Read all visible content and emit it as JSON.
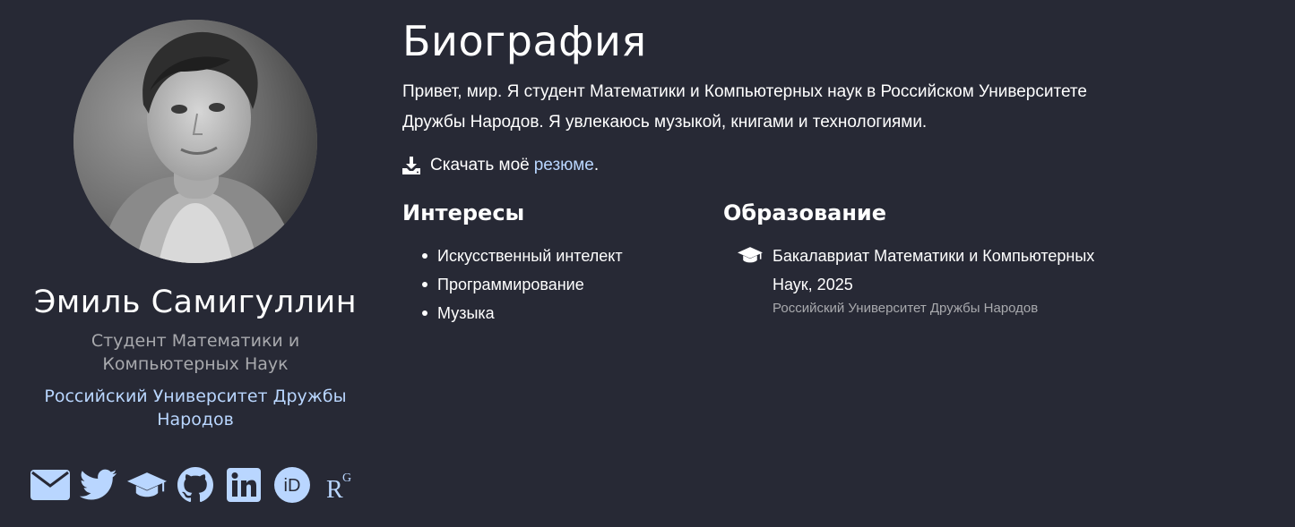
{
  "profile": {
    "name": "Эмиль Самигуллин",
    "role": "Студент Математики и Компьютерных Наук",
    "organization": "Российский Университет Дружбы Народов",
    "socials": [
      {
        "icon": "envelope-icon"
      },
      {
        "icon": "twitter-icon"
      },
      {
        "icon": "graduation-cap-icon"
      },
      {
        "icon": "github-icon"
      },
      {
        "icon": "linkedin-icon"
      },
      {
        "icon": "orcid-icon",
        "label": "iD"
      },
      {
        "icon": "researchgate-icon",
        "label": "R",
        "sup": "G"
      }
    ]
  },
  "biography": {
    "title": "Биография",
    "text": "Привет, мир. Я студент Математики и Компьютерных наук в Российском Университете Дружбы Народов. Я увлекаюсь музыкой, книгами и технологиями.",
    "resume_prefix": "Скачать моё",
    "resume_link": "резюме",
    "resume_suffix": "."
  },
  "interests": {
    "title": "Интересы",
    "items": [
      "Искусственный интелект",
      "Программирование",
      "Музыка"
    ]
  },
  "education": {
    "title": "Образование",
    "items": [
      {
        "course": "Бакалавриат Математики и Компьютерных Наук, 2025",
        "institution": "Российский Университет Дружбы Народов"
      }
    ]
  },
  "colors": {
    "background": "#272935",
    "link": "#b9d6ff",
    "muted": "#a8a9ad"
  }
}
